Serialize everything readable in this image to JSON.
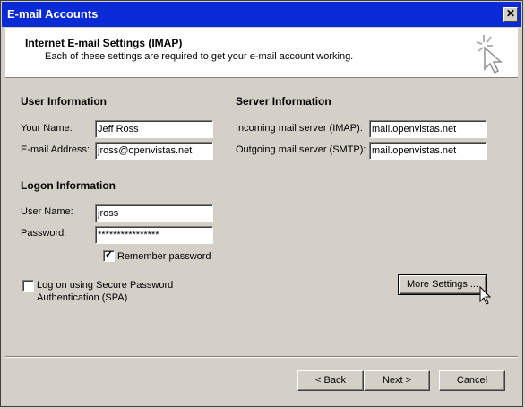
{
  "window": {
    "title": "E-mail Accounts",
    "close_label": "✕"
  },
  "header": {
    "title": "Internet E-mail Settings (IMAP)",
    "subtitle": "Each of these settings are required to get your e-mail account working.",
    "icon": "wizard-cursor-icon"
  },
  "user_info": {
    "heading": "User Information",
    "name_label": "Your Name:",
    "name_value": "Jeff Ross",
    "email_label": "E-mail Address:",
    "email_value": "jross@openvistas.net"
  },
  "server_info": {
    "heading": "Server Information",
    "incoming_label": "Incoming mail server (IMAP):",
    "incoming_value": "mail.openvistas.net",
    "outgoing_label": "Outgoing mail server (SMTP):",
    "outgoing_value": "mail.openvistas.net"
  },
  "logon_info": {
    "heading": "Logon Information",
    "username_label": "User Name:",
    "username_value": "jross",
    "password_label": "Password:",
    "password_value": "****************",
    "remember_label": "Remember password",
    "remember_checked": true
  },
  "spa": {
    "label_line1": "Log on using Secure Password",
    "label_line2": "Authentication (SPA)",
    "checked": false
  },
  "buttons": {
    "more_settings": "More Settings ...",
    "back": "< Back",
    "next": "Next >",
    "cancel": "Cancel"
  }
}
